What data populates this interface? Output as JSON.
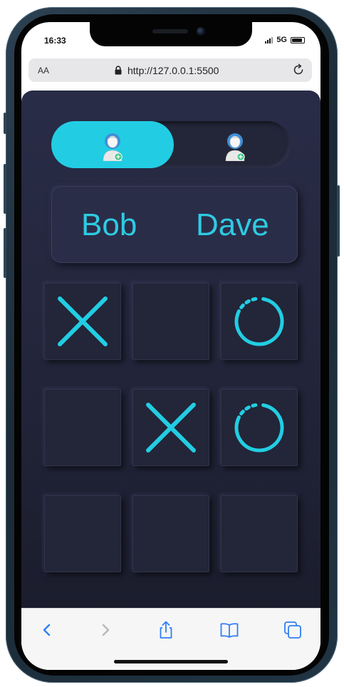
{
  "status_bar": {
    "time": "16:33",
    "network": "5G",
    "battery_level": 0.85
  },
  "browser": {
    "text_size_label": "AA",
    "url": "http://127.0.0.1:5500",
    "icons": [
      "lock-icon",
      "reload-icon"
    ]
  },
  "game": {
    "active_player_index": 0,
    "players": [
      {
        "name": "Bob",
        "avatar": "user-add-icon"
      },
      {
        "name": "Dave",
        "avatar": "user-add-icon"
      }
    ],
    "board": [
      "X",
      "",
      "O",
      "",
      "X",
      "O",
      "",
      "",
      ""
    ],
    "colors": {
      "accent": "#22cde3",
      "background": "#262940",
      "cell": "#232538"
    }
  },
  "toolbar": {
    "icons": [
      "back-icon",
      "forward-icon",
      "share-icon",
      "bookmarks-icon",
      "tabs-icon"
    ]
  }
}
